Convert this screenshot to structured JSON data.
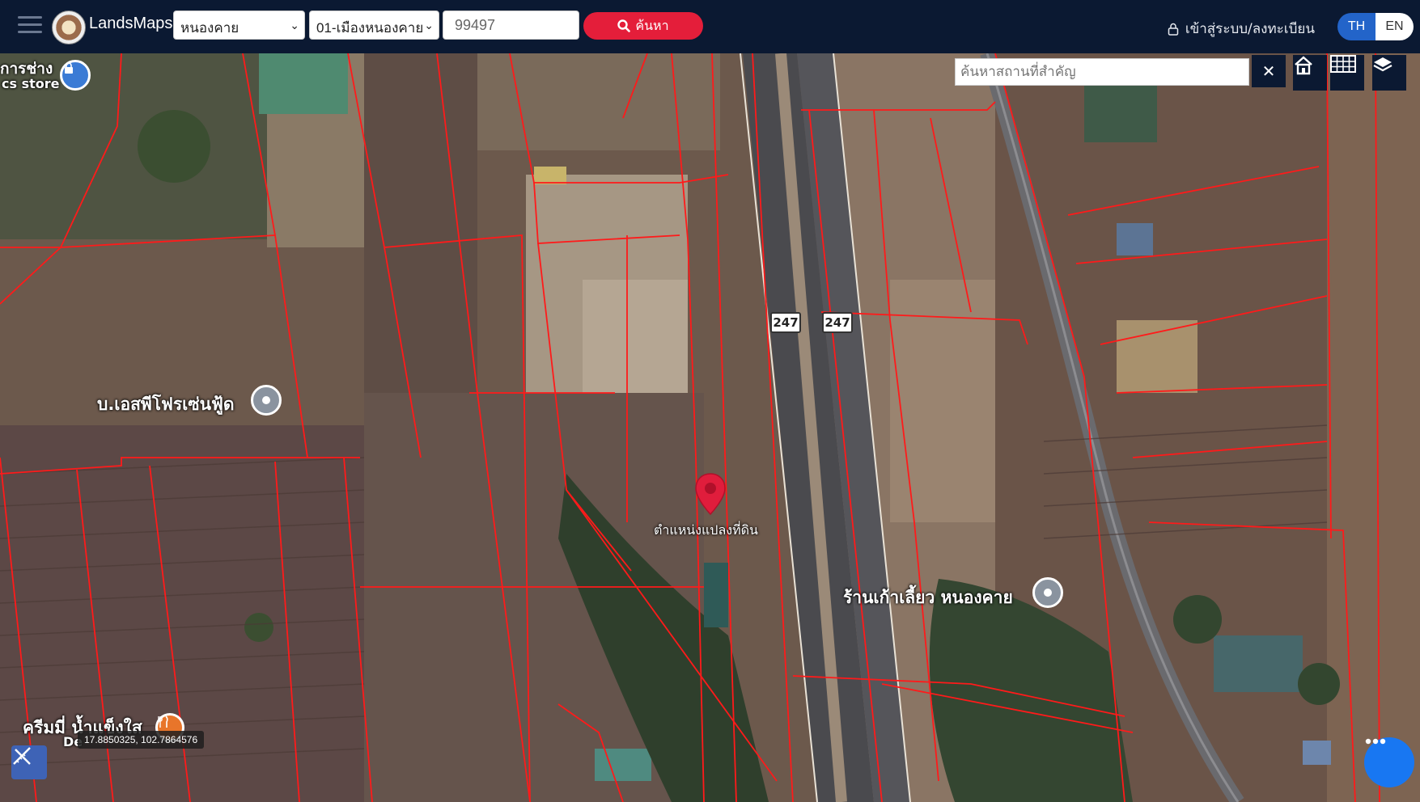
{
  "header": {
    "brand": "LandsMaps",
    "province": "หนองคาย",
    "district": "01-เมืองหนองคาย",
    "parcel_number": "99497",
    "search_label": "ค้นหา",
    "login_label": "เข้าสู่ระบบ/ลงทะเบียน",
    "lang_th": "TH",
    "lang_en": "EN",
    "active_lang": "TH"
  },
  "map": {
    "place_search_placeholder": "ค้นหาสถานที่สำคัญ",
    "clear_label": "✕",
    "poi": {
      "store_top_left_line1": "การช่าง",
      "store_top_left_line2": "cs store",
      "food_company": "บ.เอสพีโฟรเซ่นฟู้ด",
      "restaurant": "ร้านเก้าเลี้ยว หนองคาย",
      "ice_shop": "ครีมมี่ น้ำแข็งใส",
      "ice_shop_sub": "De"
    },
    "road_shields": [
      "247",
      "247"
    ],
    "parcel_marker_label": "ตำแหน่งแปลงที่ดิน",
    "coordinates": "17.8850325, 102.7864576"
  },
  "icons": {
    "menu": "hamburger-icon",
    "search": "magnifier-icon",
    "lock": "lock-icon",
    "home": "home-icon",
    "grid": "grid-icon",
    "layers": "layers-icon",
    "measure": "ruler-icon",
    "chat": "chat-icon",
    "marker": "map-pin-icon"
  },
  "colors": {
    "header_bg": "#0b1932",
    "search_button": "#e41e3a",
    "lang_active": "#2364c9",
    "parcel_lines": "#ff1a1a",
    "chat_button": "#1877f2"
  }
}
